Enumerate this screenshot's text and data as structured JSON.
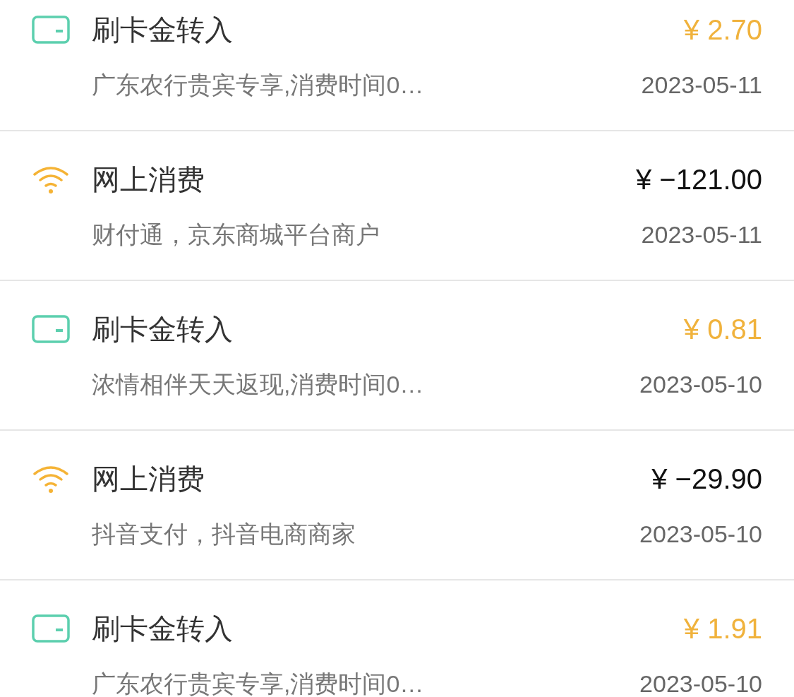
{
  "transactions": [
    {
      "kind": "card",
      "title": "刷卡金转入",
      "amount": "¥ 2.70",
      "color": "#f0b23c",
      "description": "广东农行贵宾专享,消费时间0…",
      "date": "2023-05-11"
    },
    {
      "kind": "online",
      "title": "网上消费",
      "amount": "¥ −121.00",
      "color": "#111111",
      "description": "财付通，京东商城平台商户",
      "date": "2023-05-11"
    },
    {
      "kind": "card",
      "title": "刷卡金转入",
      "amount": "¥ 0.81",
      "color": "#f0b23c",
      "description": "浓情相伴天天返现,消费时间0…",
      "date": "2023-05-10"
    },
    {
      "kind": "online",
      "title": "网上消费",
      "amount": "¥ −29.90",
      "color": "#111111",
      "description": "抖音支付，抖音电商商家",
      "date": "2023-05-10"
    },
    {
      "kind": "card",
      "title": "刷卡金转入",
      "amount": "¥ 1.91",
      "color": "#f0b23c",
      "description": "广东农行贵宾专享,消费时间0…",
      "date": "2023-05-10"
    }
  ]
}
